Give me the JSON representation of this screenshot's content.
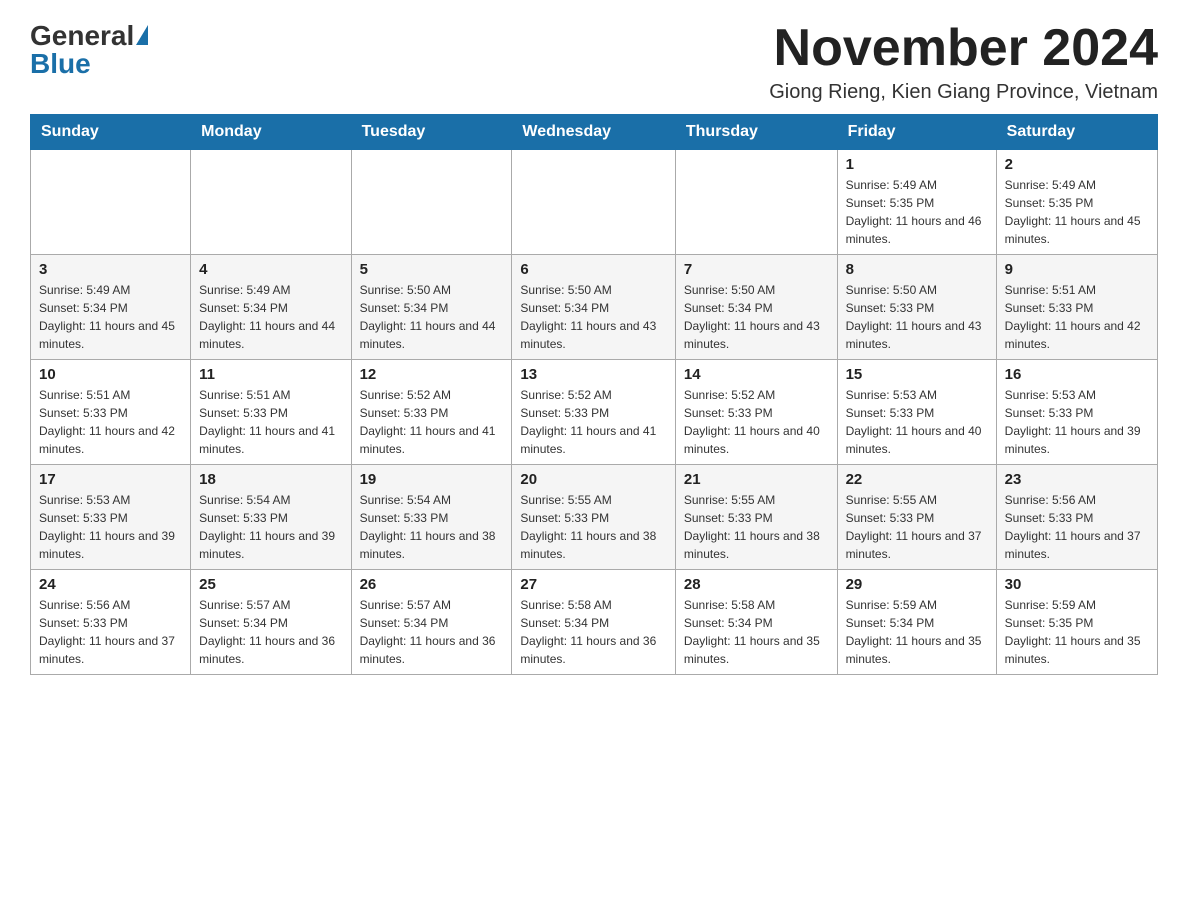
{
  "header": {
    "logo_general": "General",
    "logo_blue": "Blue",
    "month_title": "November 2024",
    "subtitle": "Giong Rieng, Kien Giang Province, Vietnam"
  },
  "days_of_week": [
    "Sunday",
    "Monday",
    "Tuesday",
    "Wednesday",
    "Thursday",
    "Friday",
    "Saturday"
  ],
  "weeks": [
    [
      {
        "day": "",
        "info": ""
      },
      {
        "day": "",
        "info": ""
      },
      {
        "day": "",
        "info": ""
      },
      {
        "day": "",
        "info": ""
      },
      {
        "day": "",
        "info": ""
      },
      {
        "day": "1",
        "info": "Sunrise: 5:49 AM\nSunset: 5:35 PM\nDaylight: 11 hours and 46 minutes."
      },
      {
        "day": "2",
        "info": "Sunrise: 5:49 AM\nSunset: 5:35 PM\nDaylight: 11 hours and 45 minutes."
      }
    ],
    [
      {
        "day": "3",
        "info": "Sunrise: 5:49 AM\nSunset: 5:34 PM\nDaylight: 11 hours and 45 minutes."
      },
      {
        "day": "4",
        "info": "Sunrise: 5:49 AM\nSunset: 5:34 PM\nDaylight: 11 hours and 44 minutes."
      },
      {
        "day": "5",
        "info": "Sunrise: 5:50 AM\nSunset: 5:34 PM\nDaylight: 11 hours and 44 minutes."
      },
      {
        "day": "6",
        "info": "Sunrise: 5:50 AM\nSunset: 5:34 PM\nDaylight: 11 hours and 43 minutes."
      },
      {
        "day": "7",
        "info": "Sunrise: 5:50 AM\nSunset: 5:34 PM\nDaylight: 11 hours and 43 minutes."
      },
      {
        "day": "8",
        "info": "Sunrise: 5:50 AM\nSunset: 5:33 PM\nDaylight: 11 hours and 43 minutes."
      },
      {
        "day": "9",
        "info": "Sunrise: 5:51 AM\nSunset: 5:33 PM\nDaylight: 11 hours and 42 minutes."
      }
    ],
    [
      {
        "day": "10",
        "info": "Sunrise: 5:51 AM\nSunset: 5:33 PM\nDaylight: 11 hours and 42 minutes."
      },
      {
        "day": "11",
        "info": "Sunrise: 5:51 AM\nSunset: 5:33 PM\nDaylight: 11 hours and 41 minutes."
      },
      {
        "day": "12",
        "info": "Sunrise: 5:52 AM\nSunset: 5:33 PM\nDaylight: 11 hours and 41 minutes."
      },
      {
        "day": "13",
        "info": "Sunrise: 5:52 AM\nSunset: 5:33 PM\nDaylight: 11 hours and 41 minutes."
      },
      {
        "day": "14",
        "info": "Sunrise: 5:52 AM\nSunset: 5:33 PM\nDaylight: 11 hours and 40 minutes."
      },
      {
        "day": "15",
        "info": "Sunrise: 5:53 AM\nSunset: 5:33 PM\nDaylight: 11 hours and 40 minutes."
      },
      {
        "day": "16",
        "info": "Sunrise: 5:53 AM\nSunset: 5:33 PM\nDaylight: 11 hours and 39 minutes."
      }
    ],
    [
      {
        "day": "17",
        "info": "Sunrise: 5:53 AM\nSunset: 5:33 PM\nDaylight: 11 hours and 39 minutes."
      },
      {
        "day": "18",
        "info": "Sunrise: 5:54 AM\nSunset: 5:33 PM\nDaylight: 11 hours and 39 minutes."
      },
      {
        "day": "19",
        "info": "Sunrise: 5:54 AM\nSunset: 5:33 PM\nDaylight: 11 hours and 38 minutes."
      },
      {
        "day": "20",
        "info": "Sunrise: 5:55 AM\nSunset: 5:33 PM\nDaylight: 11 hours and 38 minutes."
      },
      {
        "day": "21",
        "info": "Sunrise: 5:55 AM\nSunset: 5:33 PM\nDaylight: 11 hours and 38 minutes."
      },
      {
        "day": "22",
        "info": "Sunrise: 5:55 AM\nSunset: 5:33 PM\nDaylight: 11 hours and 37 minutes."
      },
      {
        "day": "23",
        "info": "Sunrise: 5:56 AM\nSunset: 5:33 PM\nDaylight: 11 hours and 37 minutes."
      }
    ],
    [
      {
        "day": "24",
        "info": "Sunrise: 5:56 AM\nSunset: 5:33 PM\nDaylight: 11 hours and 37 minutes."
      },
      {
        "day": "25",
        "info": "Sunrise: 5:57 AM\nSunset: 5:34 PM\nDaylight: 11 hours and 36 minutes."
      },
      {
        "day": "26",
        "info": "Sunrise: 5:57 AM\nSunset: 5:34 PM\nDaylight: 11 hours and 36 minutes."
      },
      {
        "day": "27",
        "info": "Sunrise: 5:58 AM\nSunset: 5:34 PM\nDaylight: 11 hours and 36 minutes."
      },
      {
        "day": "28",
        "info": "Sunrise: 5:58 AM\nSunset: 5:34 PM\nDaylight: 11 hours and 35 minutes."
      },
      {
        "day": "29",
        "info": "Sunrise: 5:59 AM\nSunset: 5:34 PM\nDaylight: 11 hours and 35 minutes."
      },
      {
        "day": "30",
        "info": "Sunrise: 5:59 AM\nSunset: 5:35 PM\nDaylight: 11 hours and 35 minutes."
      }
    ]
  ]
}
